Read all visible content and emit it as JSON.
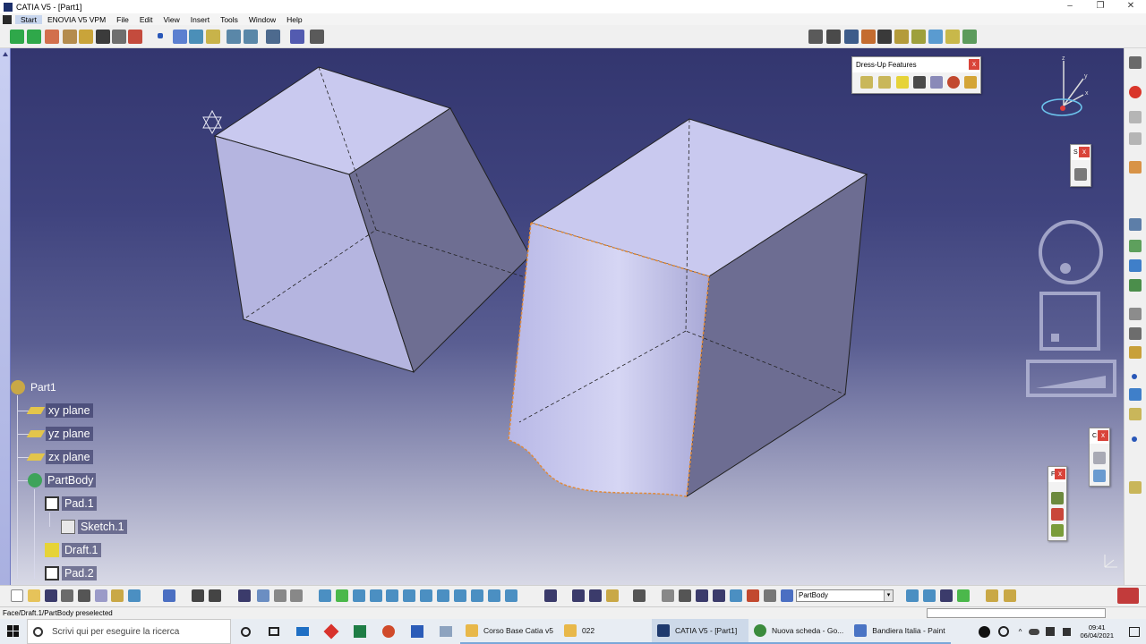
{
  "window": {
    "title": "CATIA V5 - [Part1]",
    "controls": [
      "–",
      "❐",
      "✕"
    ]
  },
  "menu": {
    "items": [
      "Start",
      "ENOVIA V5 VPM",
      "File",
      "Edit",
      "View",
      "Insert",
      "Tools",
      "Window",
      "Help"
    ]
  },
  "dressup_panel": {
    "title": "Dress-Up Features",
    "close": "x"
  },
  "small_panels": {
    "p1": "S",
    "p2": "C",
    "p3": "F",
    "close": "x"
  },
  "tree": {
    "root": "Part1",
    "xy": "xy plane",
    "yz": "yz plane",
    "zx": "zx plane",
    "body": "PartBody",
    "pad1": "Pad.1",
    "sketch1": "Sketch.1",
    "draft1": "Draft.1",
    "pad2": "Pad.2"
  },
  "compass": {
    "z": "z",
    "y": "y",
    "x": "x"
  },
  "current_body": "PartBody",
  "status": {
    "message": "Face/Draft.1/PartBody preselected"
  },
  "taskbar": {
    "search_placeholder": "Scrivi qui per eseguire la ricerca",
    "apps": [
      {
        "label": "Corso Base Catia v5",
        "color": "#e8b84a"
      },
      {
        "label": "022",
        "color": "#e8b84a"
      },
      {
        "label": "CATIA V5 - [Part1]",
        "color": "#1f3a6e"
      },
      {
        "label": "Nuova scheda - Go...",
        "color": "#3b8b3d"
      },
      {
        "label": "Bandiera Italia - Paint",
        "color": "#4a74c4"
      }
    ],
    "time": "09:41",
    "date": "06/04/2021"
  },
  "colors": {
    "viewport_top": "#33366f",
    "viewport_bottom": "#d8d9e6",
    "face_light": "#c7c7ec",
    "face_mid": "#8c8cc0",
    "face_dark": "#6d6d92",
    "preselect": "#e08a3a"
  }
}
